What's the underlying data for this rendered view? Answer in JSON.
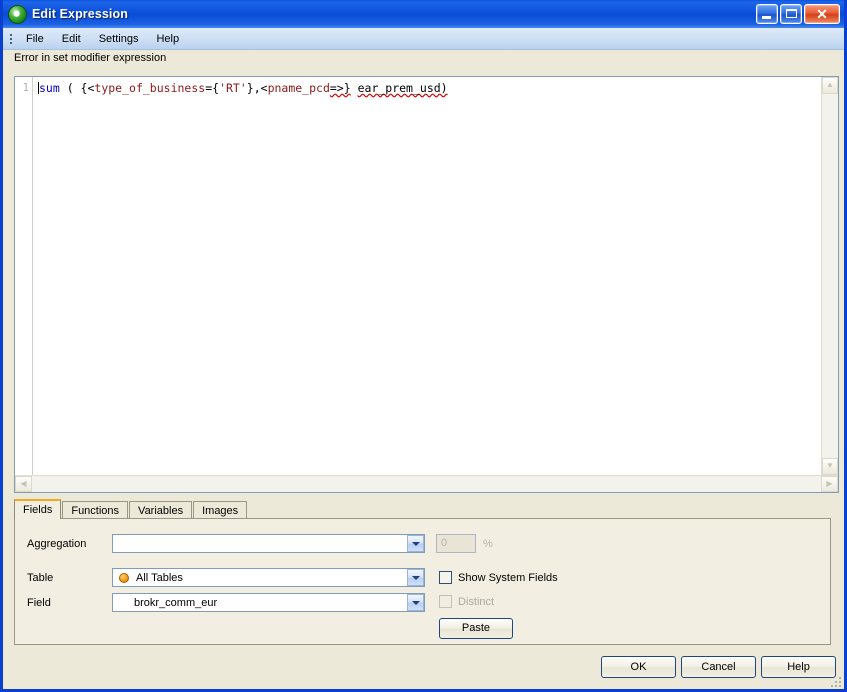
{
  "window": {
    "title": "Edit Expression",
    "app_icon": "qlikview-logo-icon",
    "min_label": "",
    "max_label": "",
    "close_label": "✕"
  },
  "menubar": {
    "grip": "menu-grip-handle",
    "items": [
      {
        "label": "File"
      },
      {
        "label": "Edit"
      },
      {
        "label": "Settings"
      },
      {
        "label": "Help"
      }
    ]
  },
  "editor": {
    "error_message": "Error in set modifier expression",
    "line_number": "1",
    "expression": "sum ( {<type_of_business={'RT'},<pname_pcd=>} ear_prem_usd)",
    "tokens": [
      {
        "text": "sum",
        "style": "fn"
      },
      {
        "text": " ( {<",
        "style": "plain"
      },
      {
        "text": "type_of_business",
        "style": "field"
      },
      {
        "text": "=",
        "style": "plain"
      },
      {
        "text": "{",
        "style": "plain"
      },
      {
        "text": "'RT'",
        "style": "str"
      },
      {
        "text": "}",
        "style": "plain"
      },
      {
        "text": ",<",
        "style": "plain"
      },
      {
        "text": "pname_pcd",
        "style": "field"
      },
      {
        "text": "=>}",
        "style": "plain-squiggle"
      },
      {
        "text": " ",
        "style": "plain"
      },
      {
        "text": "ear_prem_usd)",
        "style": "plain-squiggle"
      }
    ],
    "scroll_up": "▲",
    "scroll_down": "▼",
    "scroll_left": "◀",
    "scroll_right": "▶"
  },
  "tabs": [
    {
      "label": "Fields",
      "active": true
    },
    {
      "label": "Functions",
      "active": false
    },
    {
      "label": "Variables",
      "active": false
    },
    {
      "label": "Images",
      "active": false
    }
  ],
  "fields_panel": {
    "aggregation": {
      "label": "Aggregation",
      "value": "",
      "percent_value": "0",
      "percent_sign": "%"
    },
    "table": {
      "label": "Table",
      "value": "All Tables",
      "icon": "orange-circle-icon"
    },
    "field": {
      "label": "Field",
      "value": "brokr_comm_eur"
    },
    "show_system_fields": {
      "label": "Show System Fields",
      "checked": false,
      "enabled": true
    },
    "distinct": {
      "label": "Distinct",
      "checked": false,
      "enabled": false
    },
    "paste_label": "Paste"
  },
  "footer": {
    "ok_label": "OK",
    "cancel_label": "Cancel",
    "help_label": "Help"
  },
  "colors": {
    "titlebar_blue": "#0a4bd6",
    "window_face": "#ece9d8",
    "panel_face": "#f2efe2",
    "active_tab_accent": "#f5a623",
    "function_token": "#0000cd",
    "field_token": "#8b1a1a",
    "error_squiggle": "#d40000",
    "combo_border": "#7f9db9"
  }
}
